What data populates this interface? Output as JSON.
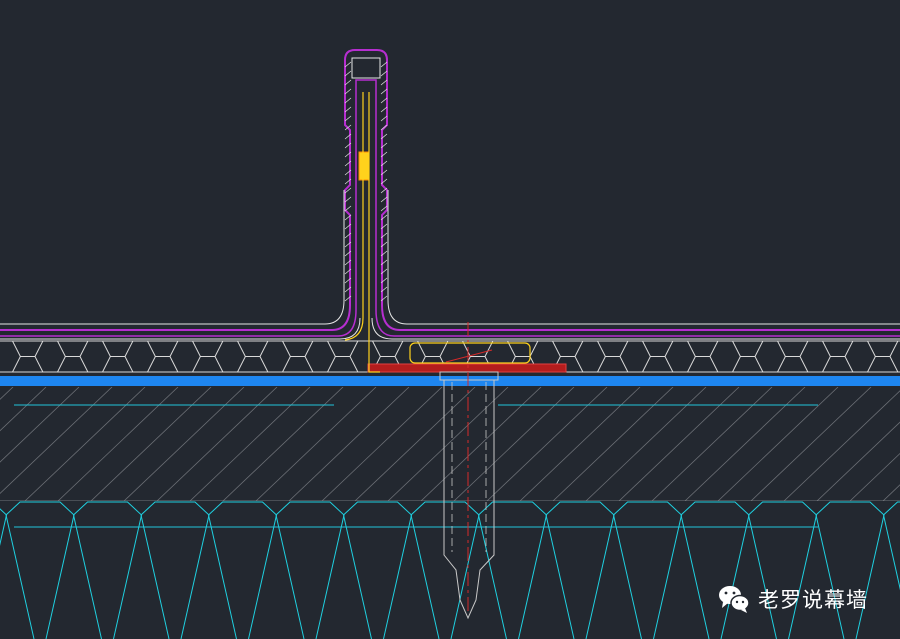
{
  "canvas": {
    "background": "#232830"
  },
  "layers": {
    "panel_outline": "#b62ed0",
    "panel_edge": "#e6e6e6",
    "sealant": "#ffd21c",
    "insulation": "#d9d9d9",
    "membrane": "#1e86f0",
    "deck_line": "#20c5da",
    "clip_plate": "#b41d1d",
    "fastener": "#c8c8c8",
    "centerline": "#d52a2a",
    "hatch": "#8a8d93",
    "purlin": "#1fd0e0"
  },
  "watermark": {
    "icon": "wechat-icon",
    "text": "老罗说幕墙"
  }
}
